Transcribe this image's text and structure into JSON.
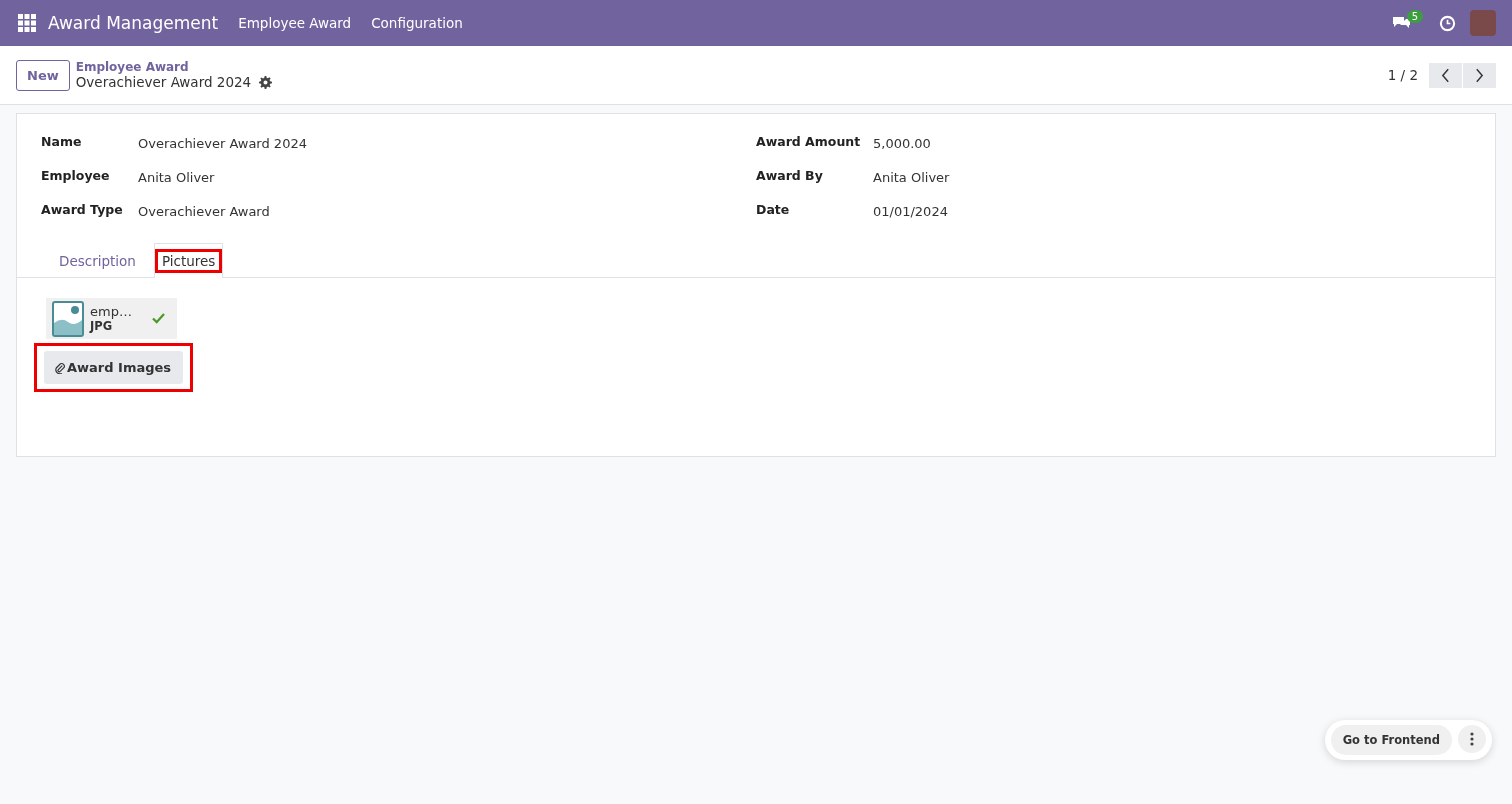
{
  "navbar": {
    "app_name": "Award Management",
    "menu": [
      "Employee Award",
      "Configuration"
    ],
    "messages_badge": "5"
  },
  "control_panel": {
    "new_button": "New",
    "breadcrumb": "Employee Award",
    "record_title": "Overachiever Award 2024",
    "pager": "1 / 2"
  },
  "form": {
    "left_fields": [
      {
        "label": "Name",
        "value": "Overachiever Award 2024"
      },
      {
        "label": "Employee",
        "value": "Anita Oliver"
      },
      {
        "label": "Award Type",
        "value": "Overachiever Award"
      }
    ],
    "right_fields": [
      {
        "label": "Award Amount",
        "value": "5,000.00"
      },
      {
        "label": "Award By",
        "value": "Anita Oliver"
      },
      {
        "label": "Date",
        "value": "01/01/2024"
      }
    ],
    "tabs": [
      {
        "label": "Description",
        "selected": false,
        "highlighted": false
      },
      {
        "label": "Pictures",
        "selected": true,
        "highlighted": true
      }
    ],
    "attachment": {
      "name": "emp…",
      "type": "JPG"
    },
    "upload_button": {
      "label": "Award Images",
      "highlighted": true
    }
  },
  "floating": {
    "button": "Go to Frontend"
  }
}
